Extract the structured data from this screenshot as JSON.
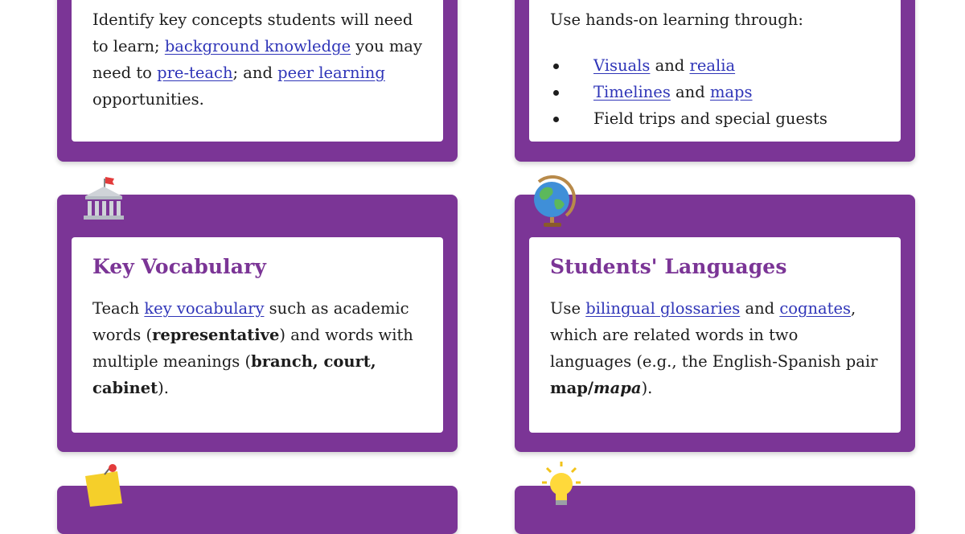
{
  "cards": {
    "top_left": {
      "text": [
        "Identify key concepts students will need to learn; ",
        "background knowledge",
        " you may need to ",
        "pre-teach",
        "; and ",
        "peer learning",
        " opportunities."
      ]
    },
    "top_right": {
      "intro": "Use hands-on learning through:",
      "items": [
        [
          "Visuals",
          " and ",
          "realia"
        ],
        [
          "Timelines",
          " and ",
          "maps"
        ],
        [
          "Field trips and special guests"
        ]
      ]
    },
    "key_vocabulary": {
      "title": "Key Vocabulary",
      "text": [
        "Teach ",
        "key vocabulary",
        " such as academic words (",
        "representative",
        ") and words with multiple meanings (",
        "branch, court, cabinet",
        ")."
      ]
    },
    "students_languages": {
      "title": "Students' Languages",
      "text": [
        "Use ",
        "bilingual glossaries",
        " and ",
        "cognates",
        ", which are related words in two languages (e.g., the English-Spanish pair ",
        "map/",
        "mapa",
        ")."
      ]
    }
  },
  "icons": [
    "building-flag-icon",
    "globe-icon",
    "sticky-note-pin-icon",
    "lightbulb-icon"
  ],
  "colors": {
    "card_purple": "#7b3596",
    "title_purple": "#7b3596",
    "link_blue": "#2f35b8"
  }
}
